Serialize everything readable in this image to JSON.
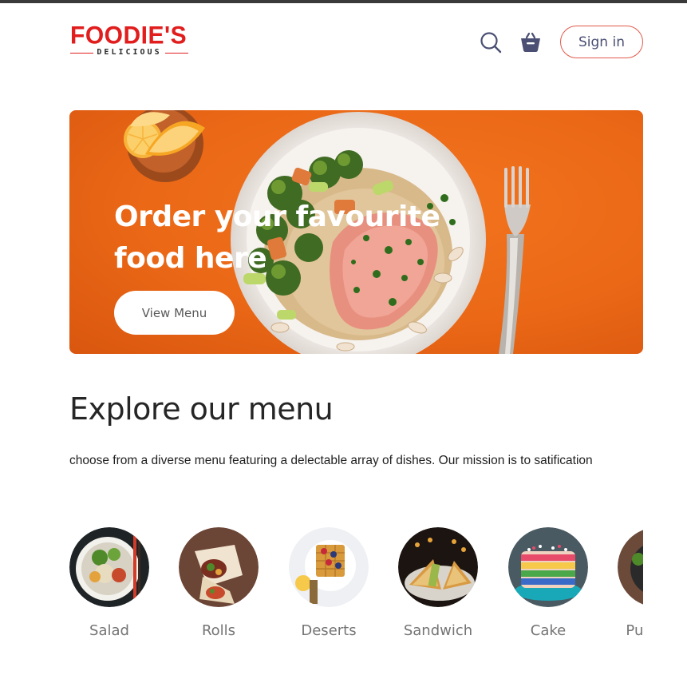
{
  "brand": {
    "name": "FOODIE'S",
    "tagline": "DELICIOUS",
    "color": "#e11d1d"
  },
  "nav": {
    "search_icon": "search-icon",
    "basket_icon": "basket-icon",
    "signin_label": "Sign in",
    "accent": "#e15a4b"
  },
  "hero": {
    "title_line1": "Order your favourite",
    "title_line2": "food here",
    "button_label": "View Menu",
    "background": "#ea6816"
  },
  "explore": {
    "title": "Explore our menu",
    "description": "choose from a diverse menu featuring a delectable array of dishes. Our mission is to satification",
    "items": [
      {
        "label": "Salad"
      },
      {
        "label": "Rolls"
      },
      {
        "label": "Deserts"
      },
      {
        "label": "Sandwich"
      },
      {
        "label": "Cake"
      },
      {
        "label": "Pure Veg"
      }
    ]
  }
}
